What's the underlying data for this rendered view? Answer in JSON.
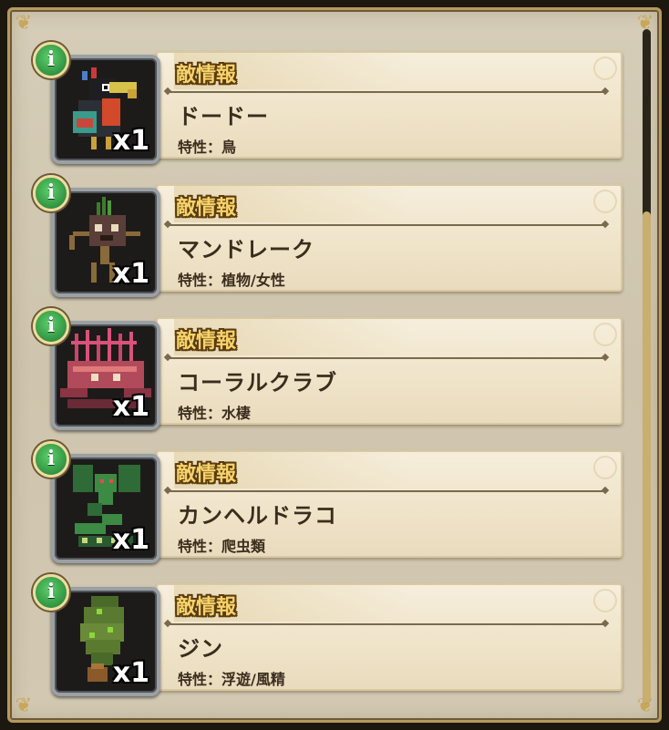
{
  "enemies": [
    {
      "heading": "敵情報",
      "name": "ドードー",
      "trait": "特性：鳥",
      "count": "x1",
      "icon": "dodo-bird-icon"
    },
    {
      "heading": "敵情報",
      "name": "マンドレーク",
      "trait": "特性：植物/女性",
      "count": "x1",
      "icon": "mandrake-icon"
    },
    {
      "heading": "敵情報",
      "name": "コーラルクラブ",
      "trait": "特性：水棲",
      "count": "x1",
      "icon": "coral-crab-icon"
    },
    {
      "heading": "敵情報",
      "name": "カンヘルドラコ",
      "trait": "特性：爬虫類",
      "count": "x1",
      "icon": "dragon-serpent-icon"
    },
    {
      "heading": "敵情報",
      "name": "ジン",
      "trait": "特性：浮遊/風精",
      "count": "x1",
      "icon": "djinn-smoke-icon"
    }
  ],
  "info_label": "i",
  "colors": {
    "accent_green": "#2e9a44",
    "heading_gold": "#f6d26a",
    "card_bg": "#f3e9d2"
  }
}
